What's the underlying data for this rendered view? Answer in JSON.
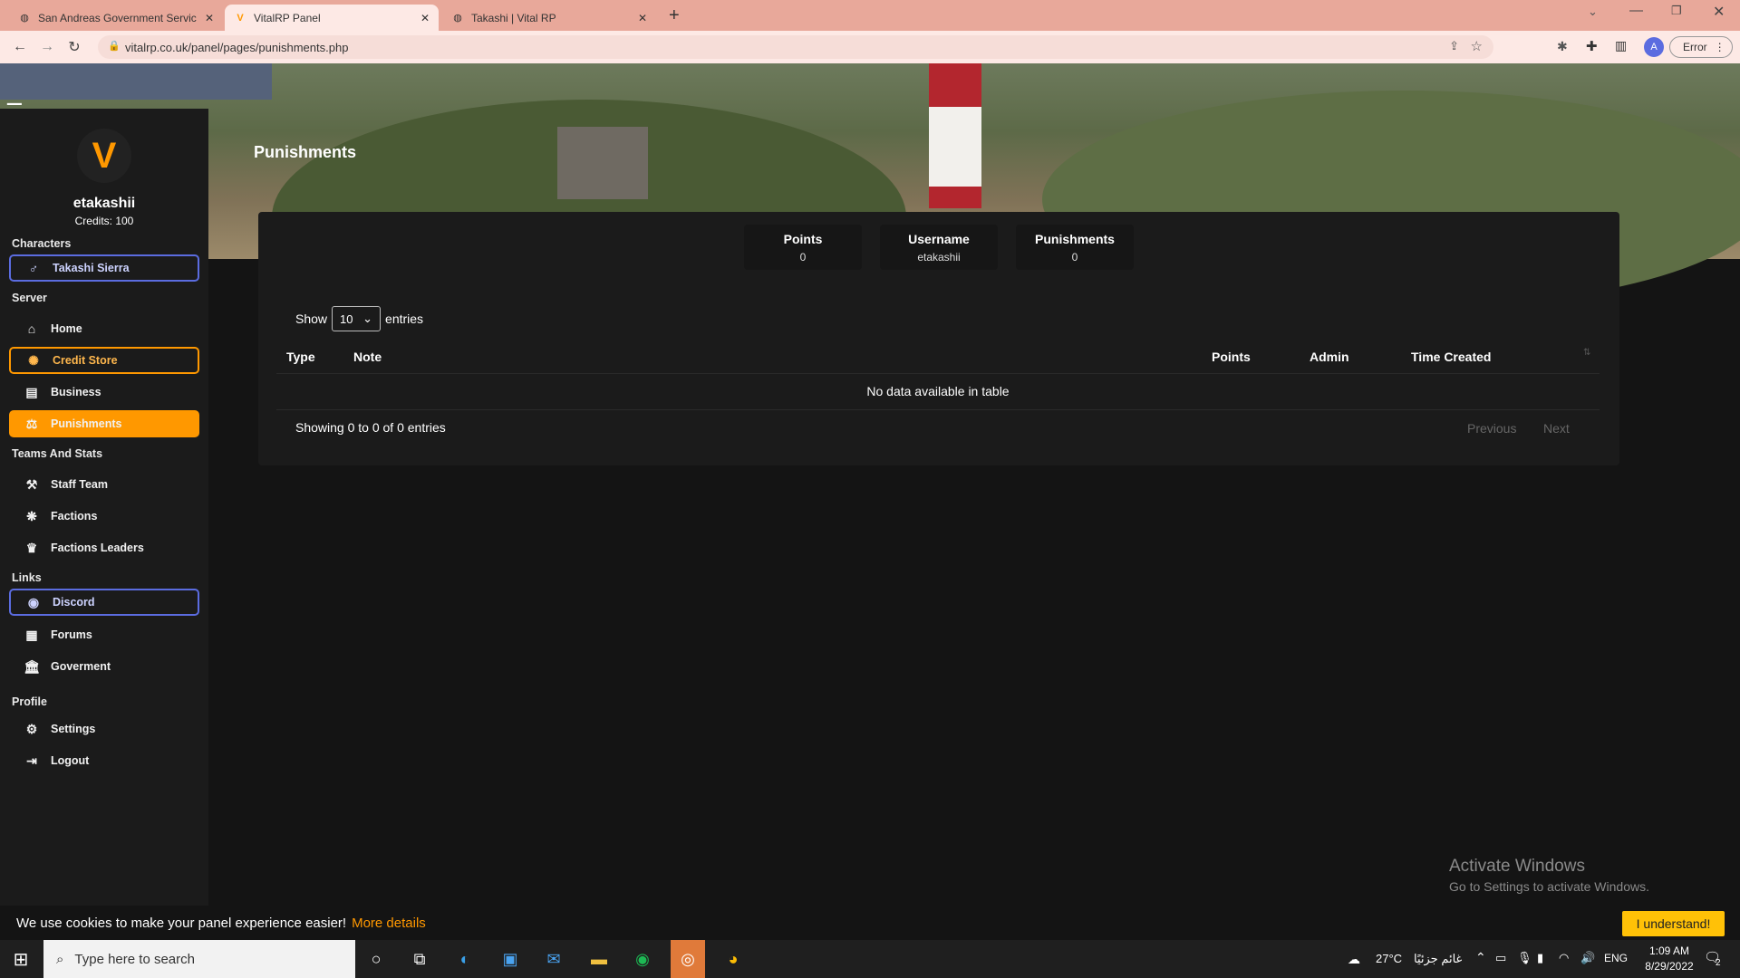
{
  "browser": {
    "tabs": [
      {
        "title": "San Andreas Government Servic",
        "active": false
      },
      {
        "title": "VitalRP Panel",
        "active": true
      },
      {
        "title": "Takashi | Vital RP",
        "active": false
      }
    ],
    "url": "vitalrp.co.uk/panel/pages/punishments.php",
    "profile_initial": "A",
    "error_label": "Error"
  },
  "page": {
    "title": "Punishments"
  },
  "sidebar": {
    "username": "etakashii",
    "credits": "Credits: 100",
    "logo_letter": "V",
    "sections": {
      "characters": "Characters",
      "server": "Server",
      "teams": "Teams And Stats",
      "links": "Links",
      "profile": "Profile"
    },
    "items": {
      "character": "Takashi Sierra",
      "home": "Home",
      "credit_store": "Credit Store",
      "business": "Business",
      "punishments": "Punishments",
      "staff_team": "Staff Team",
      "factions": "Factions",
      "faction_leaders": "Factions Leaders",
      "discord": "Discord",
      "forums": "Forums",
      "government": "Goverment",
      "settings": "Settings",
      "logout": "Logout"
    }
  },
  "stats": [
    {
      "title": "Points",
      "value": "0"
    },
    {
      "title": "Username",
      "value": "etakashii"
    },
    {
      "title": "Punishments",
      "value": "0"
    }
  ],
  "table": {
    "show_label": "Show",
    "entries_label": "entries",
    "page_size": "10",
    "columns": [
      "Type",
      "Note",
      "Points",
      "Admin",
      "Time Created"
    ],
    "empty_message": "No data available in table",
    "info": "Showing 0 to 0 of 0 entries",
    "prev_label": "Previous",
    "next_label": "Next"
  },
  "watermark": {
    "title": "Activate Windows",
    "subtitle": "Go to Settings to activate Windows."
  },
  "cookie": {
    "message": "We use cookies to make your panel experience easier!",
    "link": "More details",
    "button": "I understand!"
  },
  "taskbar": {
    "search_placeholder": "Type here to search",
    "weather": "27°C",
    "weather_text": "غائم جزئيًا",
    "language": "ENG",
    "time": "1:09 AM",
    "date": "8/29/2022",
    "notification_count": "2"
  },
  "colors": {
    "accent_orange": "#ff9800",
    "accent_blue": "#5b6ce0",
    "panel_bg": "#1b1b1b",
    "page_bg": "#141414"
  }
}
